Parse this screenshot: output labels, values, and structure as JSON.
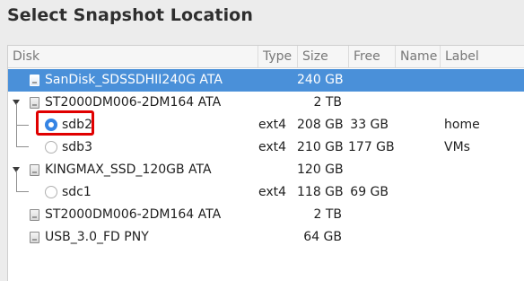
{
  "title": "Select Snapshot Location",
  "columns": {
    "disk": "Disk",
    "type": "Type",
    "size": "Size",
    "free": "Free",
    "name": "Name",
    "label": "Label"
  },
  "rows": [
    {
      "disk": "SanDisk_SDSSDHII240G ATA",
      "type": "",
      "size": "240 GB",
      "free": "",
      "name": "",
      "label": "",
      "kind": "drive",
      "selected": true
    },
    {
      "disk": "ST2000DM006-2DM164 ATA",
      "type": "",
      "size": "2 TB",
      "free": "",
      "name": "",
      "label": "",
      "kind": "drive",
      "expanded": true
    },
    {
      "disk": "sdb2",
      "type": "ext4",
      "size": "208 GB",
      "free": "33 GB",
      "name": "",
      "label": "home",
      "kind": "partition",
      "checked": true
    },
    {
      "disk": "sdb3",
      "type": "ext4",
      "size": "210 GB",
      "free": "177 GB",
      "name": "",
      "label": "VMs",
      "kind": "partition",
      "checked": false
    },
    {
      "disk": "KINGMAX_SSD_120GB ATA",
      "type": "",
      "size": "120 GB",
      "free": "",
      "name": "",
      "label": "",
      "kind": "drive",
      "expanded": true
    },
    {
      "disk": "sdc1",
      "type": "ext4",
      "size": "118 GB",
      "free": "69 GB",
      "name": "",
      "label": "",
      "kind": "partition",
      "checked": false
    },
    {
      "disk": "ST2000DM006-2DM164 ATA",
      "type": "",
      "size": "2 TB",
      "free": "",
      "name": "",
      "label": "",
      "kind": "drive"
    },
    {
      "disk": "USB_3.0_FD PNY",
      "type": "",
      "size": "64 GB",
      "free": "",
      "name": "",
      "label": "",
      "kind": "drive"
    }
  ],
  "colors": {
    "selection": "#4a90d9",
    "radio_checked": "#3584e4",
    "highlight_box": "#e00000"
  }
}
